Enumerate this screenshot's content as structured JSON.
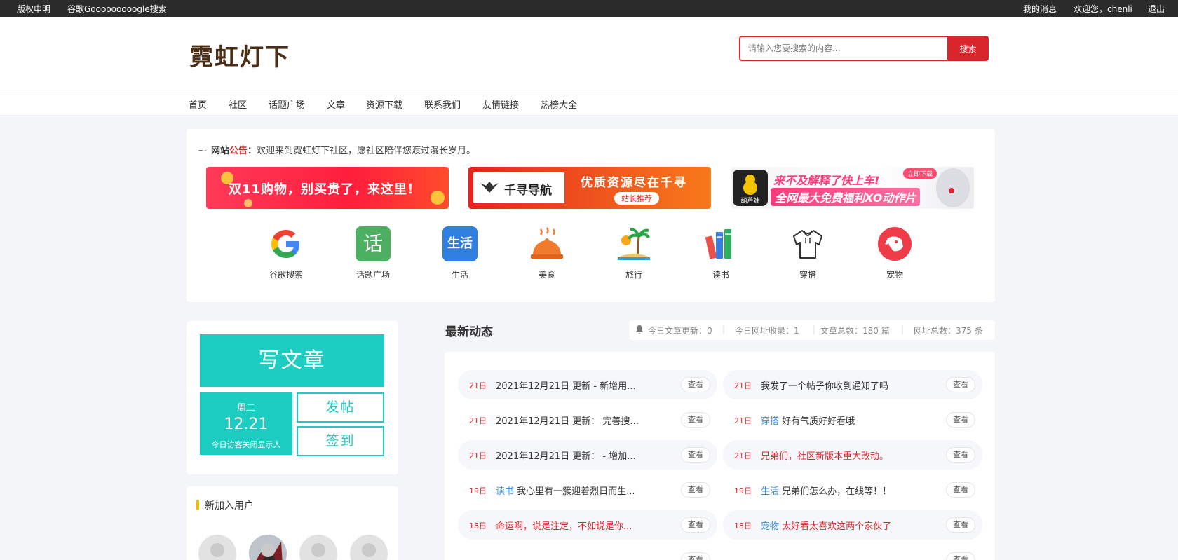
{
  "topbar": {
    "copyright": "版权申明",
    "google": "谷歌Gooooooooogle搜索",
    "messages": "我的消息",
    "welcome": "欢迎您，chenli",
    "logout": "退出"
  },
  "header": {
    "logo": "霓虹灯下",
    "search_placeholder": "请输入您要搜索的内容...",
    "search_button": "搜索"
  },
  "nav": [
    "首页",
    "社区",
    "话题广场",
    "文章",
    "资源下载",
    "联系我们",
    "友情链接",
    "热榜大全"
  ],
  "notice": {
    "label_a": "网站",
    "label_b": "公告",
    "colon": "：",
    "text": "欢迎来到霓虹灯下社区，愿社区陪伴您渡过漫长岁月。"
  },
  "banners": [
    {
      "text": "双11购物，别买贵了，来这里！"
    },
    {
      "brand": "千寻导航",
      "text": "优质资源尽在千寻",
      "badge": "站长推荐"
    },
    {
      "text_a": "来不及解释了快上车!",
      "text_b": "全网最大免费福利XO动作片",
      "badge": "立即下载",
      "app": "葫芦娃"
    }
  ],
  "categories": [
    {
      "label": "谷歌搜索",
      "icon": "google-icon"
    },
    {
      "label": "话题广场",
      "icon": "topic-icon",
      "glyph": "话"
    },
    {
      "label": "生活",
      "icon": "life-icon",
      "glyph": "生活"
    },
    {
      "label": "美食",
      "icon": "food-icon"
    },
    {
      "label": "旅行",
      "icon": "travel-icon"
    },
    {
      "label": "读书",
      "icon": "books-icon"
    },
    {
      "label": "穿搭",
      "icon": "clothing-icon"
    },
    {
      "label": "宠物",
      "icon": "pet-icon"
    }
  ],
  "sidebar": {
    "write": "写文章",
    "weekday": "周二",
    "date": "12.21",
    "visitor_note": "今日访客关闭显示人",
    "post": "发帖",
    "checkin": "签到",
    "new_users_title": "新加入用户"
  },
  "feed": {
    "title": "最新动态",
    "stats": {
      "today_articles": "今日文章更新：0",
      "today_sites": "今日网址收录：1",
      "total_articles": "文章总数：180 篇",
      "total_sites": "网址总数：375 条"
    },
    "view_label": "查看",
    "left": [
      {
        "day": "21日",
        "tag": "",
        "title": "2021年12月21日 更新 - 新增用...",
        "red": false
      },
      {
        "day": "21日",
        "tag": "",
        "title": "2021年12月21日 更新： 完善搜...",
        "red": false
      },
      {
        "day": "21日",
        "tag": "",
        "title": "2021年12月21日 更新： - 增加...",
        "red": false
      },
      {
        "day": "19日",
        "tag": "读书",
        "title": "我心里有一簇迎着烈日而生...",
        "red": false
      },
      {
        "day": "18日",
        "tag": "",
        "title": "命运啊，说是注定，不如说是你...",
        "red": true
      }
    ],
    "right": [
      {
        "day": "21日",
        "tag": "",
        "title": "我发了一个帖子你收到通知了吗",
        "red": false
      },
      {
        "day": "21日",
        "tag": "穿搭",
        "title": "好有气质好好看哦",
        "red": false
      },
      {
        "day": "21日",
        "tag": "",
        "title": "兄弟们，社区新版本重大改动。",
        "red": true
      },
      {
        "day": "19日",
        "tag": "生活",
        "title": "兄弟们怎么办，在线等！！",
        "red": false
      },
      {
        "day": "18日",
        "tag": "宠物",
        "title": "太好看太喜欢这两个家伙了",
        "red": true
      }
    ]
  },
  "colors": {
    "accent_red": "#d9262c",
    "teal": "#1dcdc1",
    "link_blue": "#3a8ee6"
  }
}
